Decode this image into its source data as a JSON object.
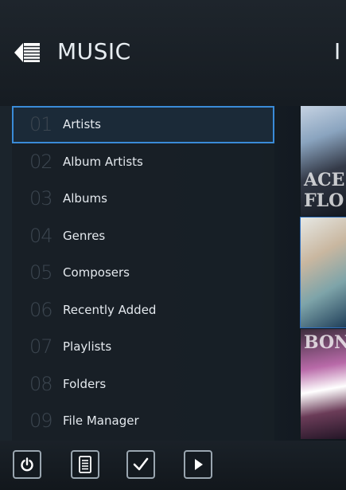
{
  "header": {
    "title": "MUSIC",
    "right_text": "I"
  },
  "menu": {
    "items": [
      {
        "num": "01",
        "label": "Artists",
        "selected": true
      },
      {
        "num": "02",
        "label": "Album Artists"
      },
      {
        "num": "03",
        "label": "Albums"
      },
      {
        "num": "04",
        "label": "Genres"
      },
      {
        "num": "05",
        "label": "Composers"
      },
      {
        "num": "06",
        "label": "Recently Added"
      },
      {
        "num": "07",
        "label": "Playlists"
      },
      {
        "num": "08",
        "label": "Folders"
      },
      {
        "num": "09",
        "label": "File Manager"
      }
    ]
  },
  "albums": [
    {
      "art_text": "ACE FLO"
    },
    {
      "art_text": ""
    },
    {
      "art_text": "BON"
    }
  ],
  "toolbar": {
    "buttons": [
      {
        "icon": "power-icon"
      },
      {
        "icon": "list-icon"
      },
      {
        "icon": "checkmark-icon"
      },
      {
        "icon": "play-icon"
      }
    ]
  },
  "colors": {
    "accent": "#3a8bd8",
    "text": "#e4e9ee",
    "number": "#3c4650"
  }
}
